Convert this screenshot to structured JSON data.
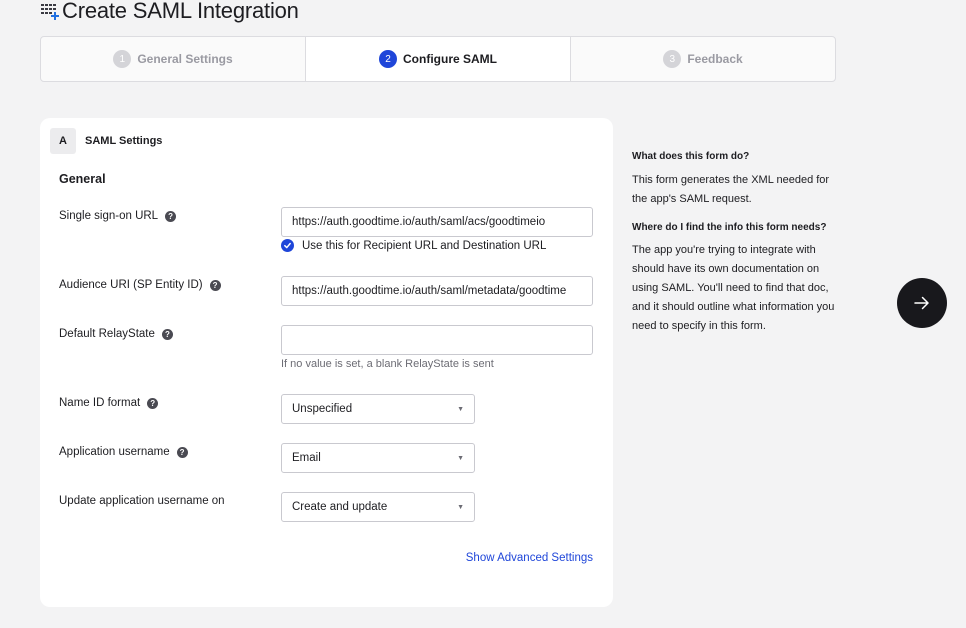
{
  "page": {
    "title": "Create SAML Integration"
  },
  "stepper": {
    "steps": [
      {
        "number": "1",
        "label": "General Settings",
        "state": "inactive"
      },
      {
        "number": "2",
        "label": "Configure SAML",
        "state": "active"
      },
      {
        "number": "3",
        "label": "Feedback",
        "state": "inactive"
      }
    ]
  },
  "card": {
    "section_letter": "A",
    "section_title": "SAML Settings",
    "group_heading": "General",
    "fields": {
      "sso_url": {
        "label": "Single sign-on URL",
        "value": "https://auth.goodtime.io/auth/saml/acs/goodtimeio",
        "checkbox_label": "Use this for Recipient URL and Destination URL",
        "checkbox_checked": true
      },
      "audience_uri": {
        "label": "Audience URI (SP Entity ID)",
        "value": "https://auth.goodtime.io/auth/saml/metadata/goodtime"
      },
      "relay_state": {
        "label": "Default RelayState",
        "value": "",
        "hint": "If no value is set, a blank RelayState is sent"
      },
      "name_id_format": {
        "label": "Name ID format",
        "selected": "Unspecified"
      },
      "app_username": {
        "label": "Application username",
        "selected": "Email"
      },
      "update_username_on": {
        "label": "Update application username on",
        "selected": "Create and update"
      }
    },
    "advanced_link": "Show Advanced Settings"
  },
  "help": {
    "q1": "What does this form do?",
    "a1": "This form generates the XML needed for the app's SAML request.",
    "q2": "Where do I find the info this form needs?",
    "a2": "The app you're trying to integrate with should have its own documentation on using SAML. You'll need to find that doc, and it should outline what information you need to specify in this form."
  },
  "icons": {
    "title_icon": "grid-plus-icon",
    "help_icon": "question-circle-icon",
    "checkbox_icon": "check-icon",
    "select_arrow": "caret-down-icon",
    "next_icon": "arrow-right-icon"
  },
  "colors": {
    "accent": "#1f46d9",
    "background": "#f3f3f4",
    "fab": "#18181c"
  }
}
